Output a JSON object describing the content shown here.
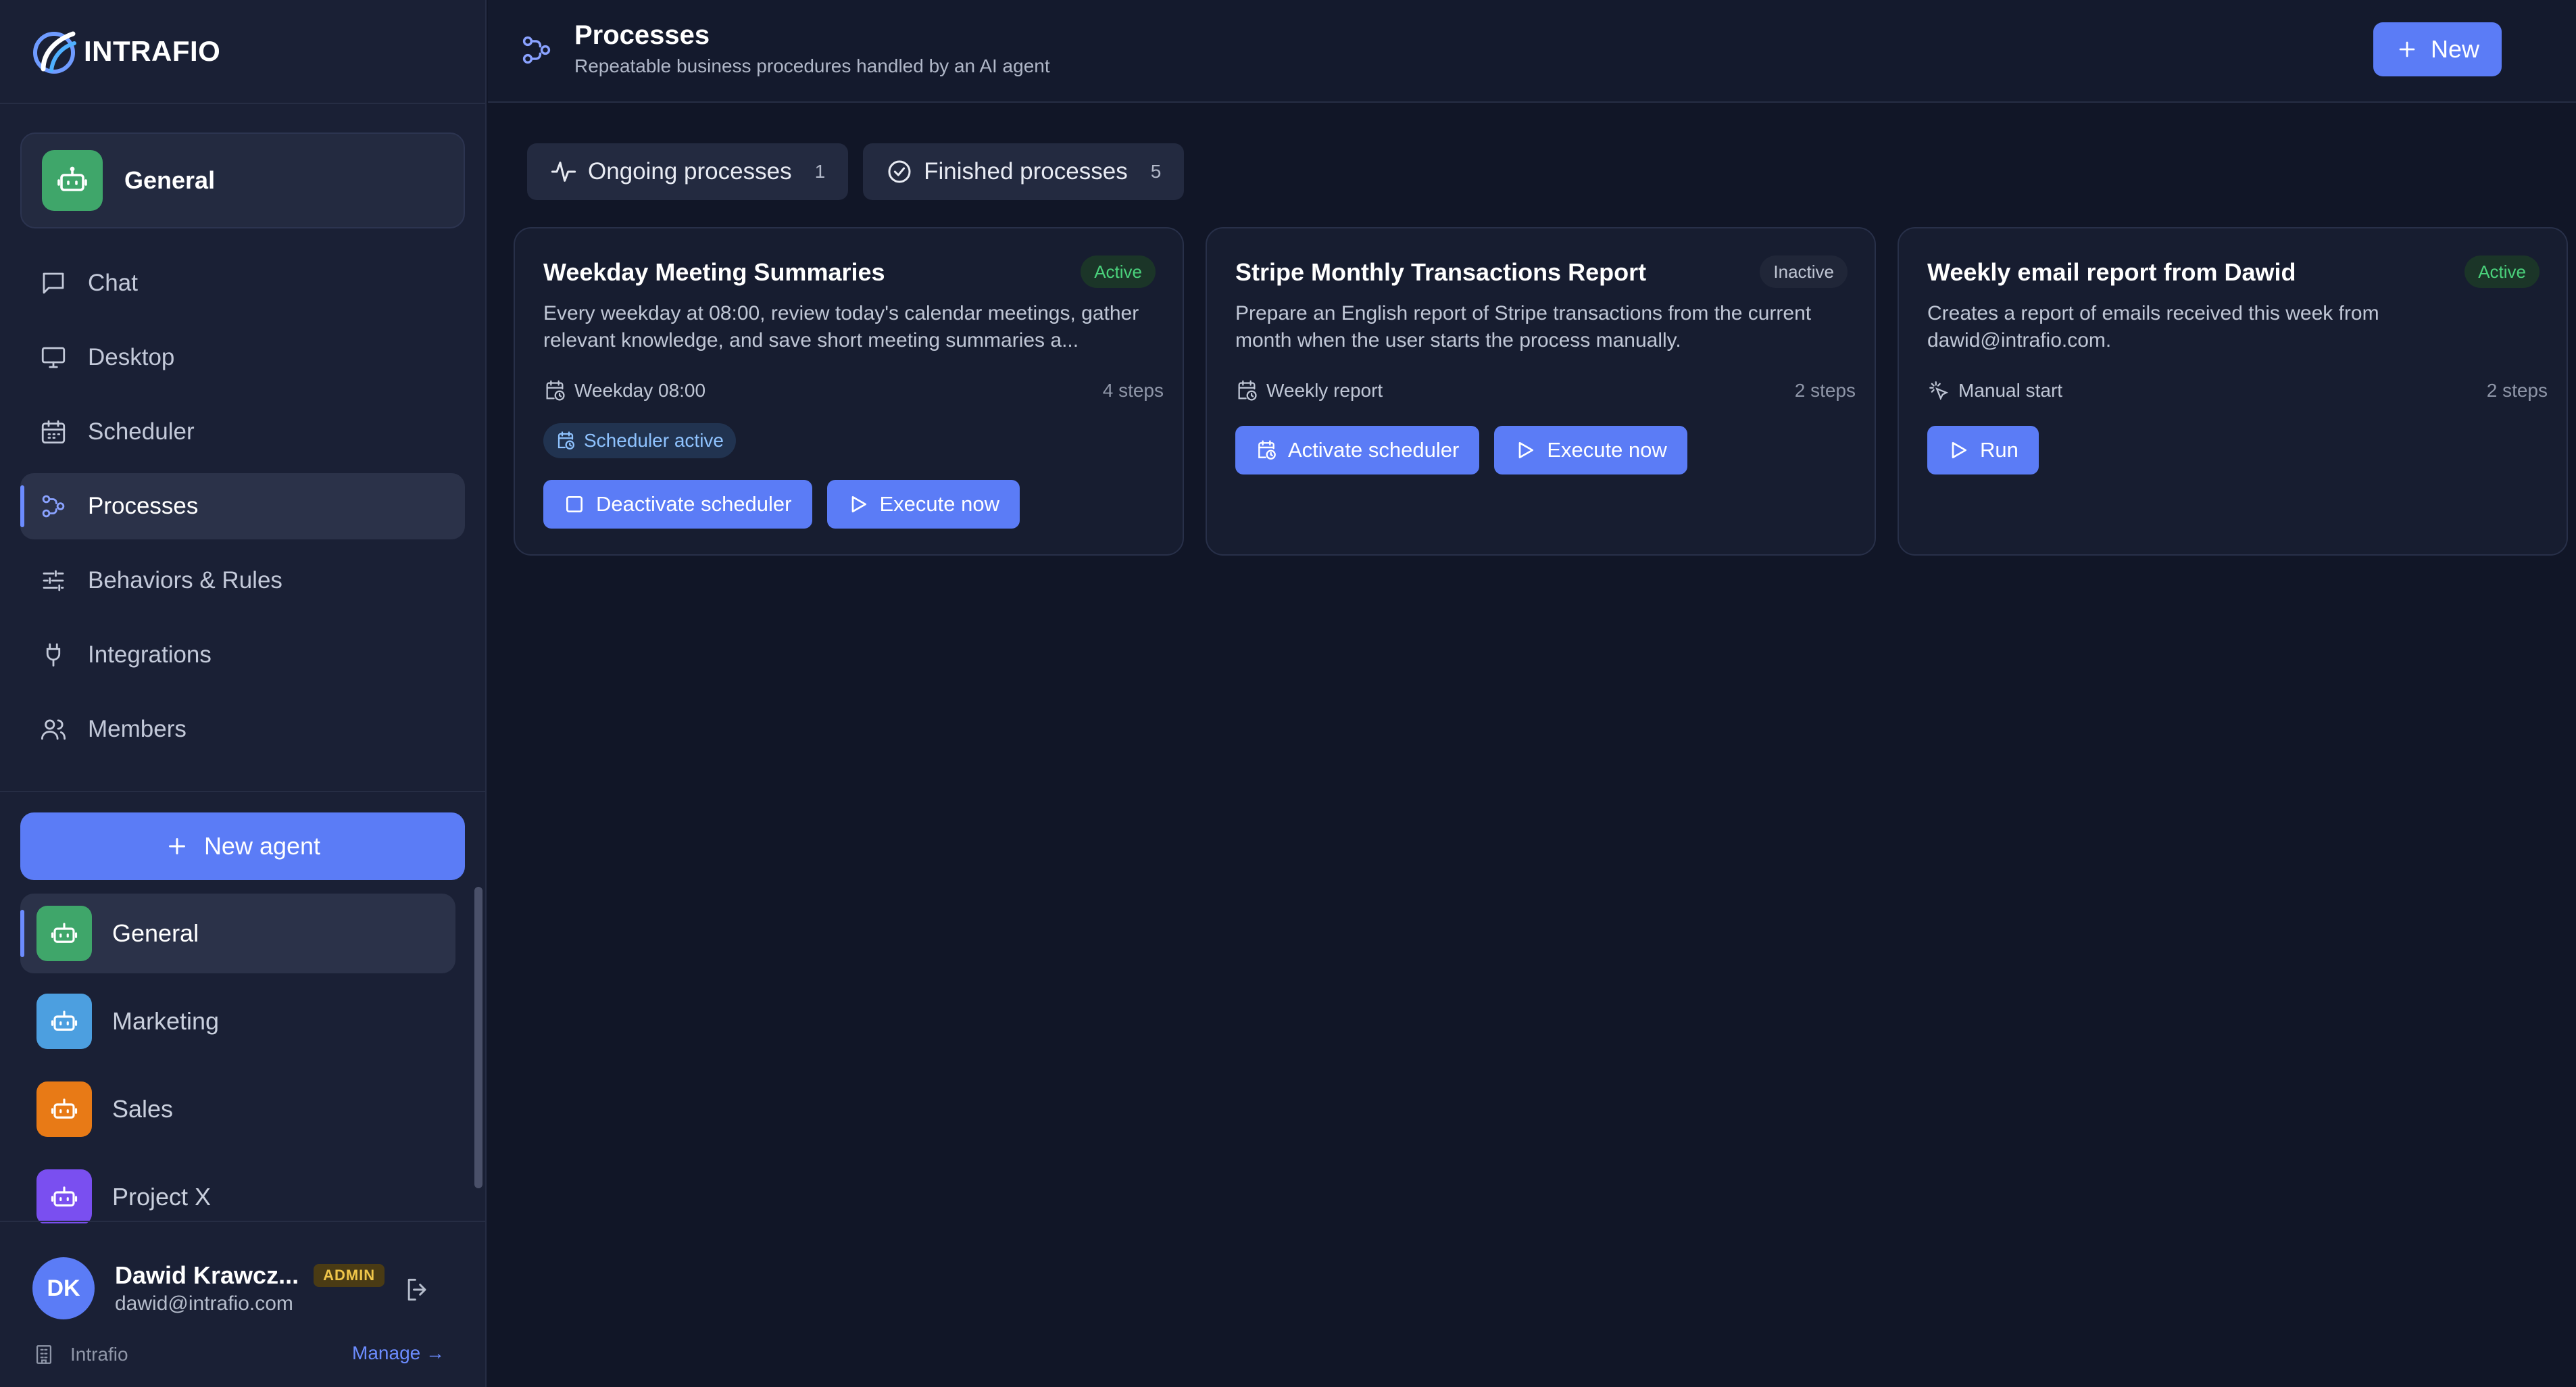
{
  "app": {
    "brand": "INTRAFIO"
  },
  "current_agent": {
    "name": "General",
    "color": "#3fa66a"
  },
  "nav": [
    {
      "label": "Chat",
      "icon": "chat-icon"
    },
    {
      "label": "Desktop",
      "icon": "monitor-icon"
    },
    {
      "label": "Scheduler",
      "icon": "calendar-icon"
    },
    {
      "label": "Processes",
      "icon": "workflow-icon",
      "active": true
    },
    {
      "label": "Behaviors & Rules",
      "icon": "sliders-icon"
    },
    {
      "label": "Integrations",
      "icon": "plug-icon"
    },
    {
      "label": "Members",
      "icon": "users-icon"
    }
  ],
  "new_agent_label": "New agent",
  "agents": [
    {
      "name": "General",
      "color": "#3fa66a",
      "active": true
    },
    {
      "name": "Marketing",
      "color": "#4c9fe0"
    },
    {
      "name": "Sales",
      "color": "#e87a16"
    },
    {
      "name": "Project X",
      "color": "#7a4ff0"
    }
  ],
  "user": {
    "initials": "DK",
    "name": "Dawid Krawcz...",
    "role": "ADMIN",
    "email": "dawid@intrafio.com"
  },
  "org": {
    "name": "Intrafio",
    "manage_label": "Manage →"
  },
  "header": {
    "title": "Processes",
    "subtitle": "Repeatable business procedures handled by an AI agent",
    "new_label": "New"
  },
  "tabs": [
    {
      "label": "Ongoing processes",
      "count": "1",
      "icon": "activity-icon"
    },
    {
      "label": "Finished processes",
      "count": "5",
      "icon": "check-circle-icon"
    }
  ],
  "processes": [
    {
      "title": "Weekday Meeting Summaries",
      "status": "Active",
      "description": "Every weekday at 08:00, review today's calendar meetings, gather relevant knowledge, and save short meeting summaries a...",
      "trigger": "Weekday 08:00",
      "steps": "4 steps",
      "chip": "Scheduler active",
      "actions": [
        "Deactivate scheduler",
        "Execute now"
      ]
    },
    {
      "title": "Stripe Monthly Transactions Report",
      "status": "Inactive",
      "description": "Prepare an English report of Stripe transactions from the current month when the user starts the process manually.",
      "trigger": "Weekly report",
      "steps": "2 steps",
      "actions": [
        "Activate scheduler",
        "Execute now"
      ]
    },
    {
      "title": "Weekly email report from Dawid",
      "status": "Active",
      "description": "Creates a report of emails received this week from dawid@intrafio.com.",
      "trigger": "Manual start",
      "steps": "2 steps",
      "actions": [
        "Run"
      ]
    }
  ],
  "colors": {
    "accent": "#5b7cf6",
    "background": "#111627",
    "sidebar": "#1a2035",
    "active_status": "#4ad17b",
    "admin_badge": "#f0c64a"
  }
}
